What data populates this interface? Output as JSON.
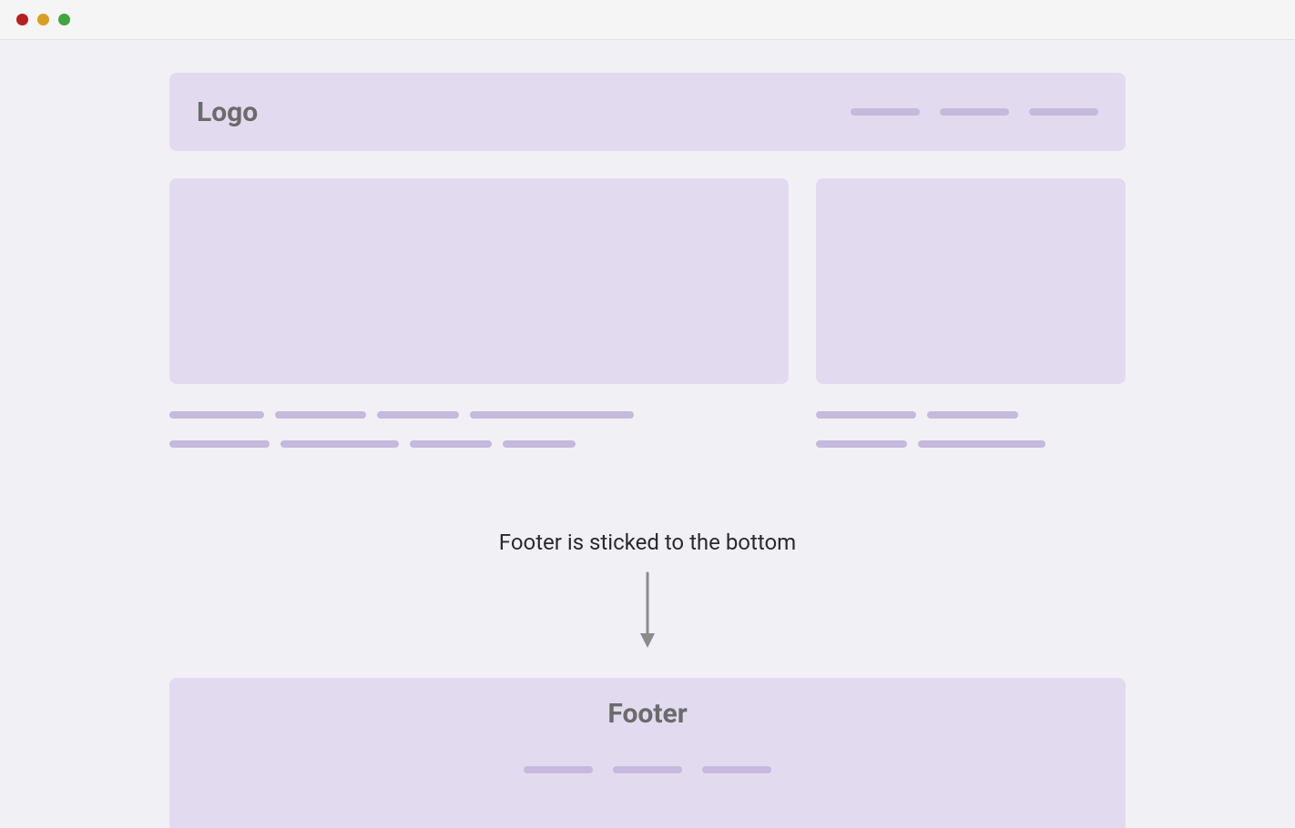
{
  "titlebar": {
    "red": "close",
    "yellow": "minimize",
    "green": "zoom"
  },
  "header": {
    "logo_label": "Logo",
    "nav_items": 3
  },
  "content": {
    "left": {
      "text_bar_widths_row1": [
        104,
        100,
        90,
        180
      ],
      "text_bar_widths_row2": [
        110,
        130,
        90,
        80
      ]
    },
    "right": {
      "text_bar_widths_row1": [
        110,
        100
      ],
      "text_bar_widths_row2": [
        100,
        140
      ]
    }
  },
  "annotation": {
    "text": "Footer is sticked to the bottom"
  },
  "footer": {
    "title_label": "Footer",
    "link_items": 3
  }
}
